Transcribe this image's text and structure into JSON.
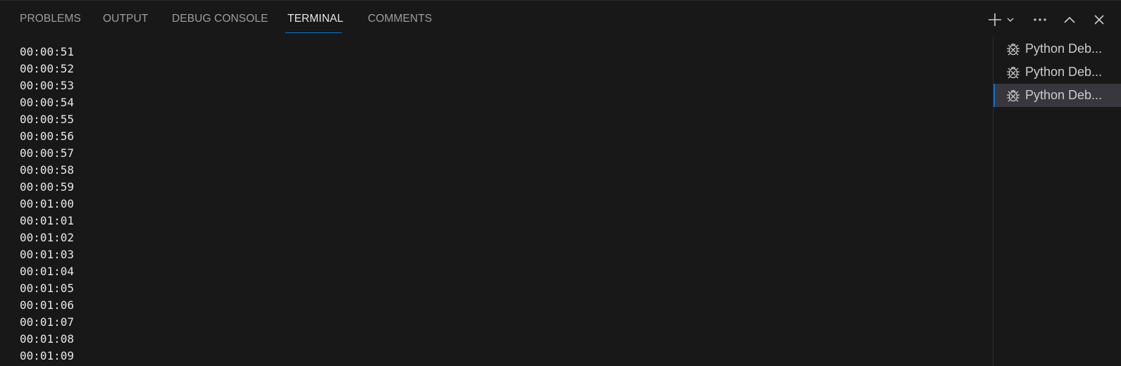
{
  "panel": {
    "tabs": [
      {
        "label": "PROBLEMS"
      },
      {
        "label": "OUTPUT"
      },
      {
        "label": "DEBUG CONSOLE"
      },
      {
        "label": "TERMINAL"
      },
      {
        "label": "COMMENTS"
      }
    ],
    "active_tab": "TERMINAL",
    "actions": [
      {
        "icon": "plus-icon"
      },
      {
        "icon": "chevron-down-icon"
      },
      {
        "icon": "ellipsis-icon"
      },
      {
        "icon": "chevron-up-icon"
      },
      {
        "icon": "close-icon"
      }
    ]
  },
  "terminal": {
    "lines": [
      "00:00:51",
      "00:00:52",
      "00:00:53",
      "00:00:54",
      "00:00:55",
      "00:00:56",
      "00:00:57",
      "00:00:58",
      "00:00:59",
      "00:01:00",
      "00:01:01",
      "00:01:02",
      "00:01:03",
      "00:01:04",
      "00:01:05",
      "00:01:06",
      "00:01:07",
      "00:01:08",
      "00:01:09"
    ]
  },
  "terminal_list": {
    "items": [
      {
        "label": "Python Deb...",
        "icon": "debug-icon",
        "active": false
      },
      {
        "label": "Python Deb...",
        "icon": "debug-icon",
        "active": false
      },
      {
        "label": "Python Deb...",
        "icon": "debug-icon",
        "active": true
      }
    ]
  },
  "colors": {
    "background": "#181818",
    "accent": "#0078d4",
    "active_item_bg": "#37373d"
  }
}
